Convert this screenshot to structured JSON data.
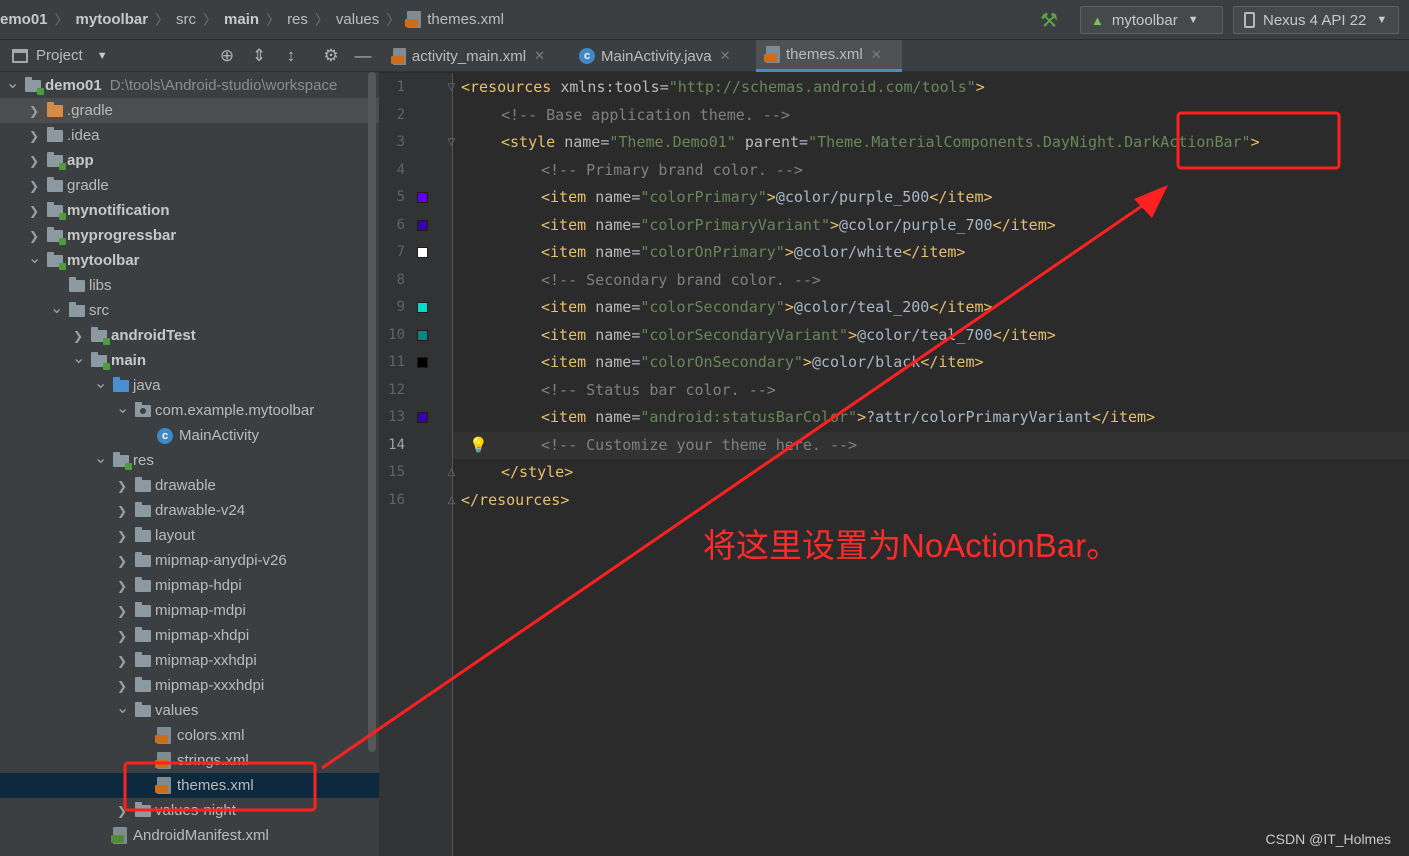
{
  "breadcrumbs": [
    {
      "label": "emo01",
      "bold": true
    },
    {
      "label": "mytoolbar",
      "bold": true
    },
    {
      "label": "src",
      "bold": false
    },
    {
      "label": "main",
      "bold": true
    },
    {
      "label": "res",
      "bold": false
    },
    {
      "label": "values",
      "bold": false
    }
  ],
  "current_file": "themes.xml",
  "toolbar": {
    "run_config": "mytoolbar",
    "device": "Nexus 4 API 22"
  },
  "project_panel": {
    "title": "Project"
  },
  "tree": [
    {
      "label": "demo01",
      "path": "D:\\tools\\Android-studio\\workspace",
      "bold": true,
      "depth": 0,
      "chev": "open",
      "icon": "module"
    },
    {
      "label": ".gradle",
      "bold": false,
      "depth": 1,
      "chev": "closed",
      "icon": "orange",
      "highlight": true
    },
    {
      "label": ".idea",
      "bold": false,
      "depth": 1,
      "chev": "closed",
      "icon": "folder"
    },
    {
      "label": "app",
      "bold": true,
      "depth": 1,
      "chev": "closed",
      "icon": "module"
    },
    {
      "label": "gradle",
      "bold": false,
      "depth": 1,
      "chev": "closed",
      "icon": "folder"
    },
    {
      "label": "mynotification",
      "bold": true,
      "depth": 1,
      "chev": "closed",
      "icon": "module"
    },
    {
      "label": "myprogressbar",
      "bold": true,
      "depth": 1,
      "chev": "closed",
      "icon": "module"
    },
    {
      "label": "mytoolbar",
      "bold": true,
      "depth": 1,
      "chev": "open",
      "icon": "module"
    },
    {
      "label": "libs",
      "bold": false,
      "depth": 2,
      "chev": "none",
      "icon": "folder"
    },
    {
      "label": "src",
      "bold": false,
      "depth": 2,
      "chev": "open",
      "icon": "folder"
    },
    {
      "label": "androidTest",
      "bold": true,
      "depth": 3,
      "chev": "closed",
      "icon": "module"
    },
    {
      "label": "main",
      "bold": true,
      "depth": 3,
      "chev": "open",
      "icon": "module"
    },
    {
      "label": "java",
      "bold": false,
      "depth": 4,
      "chev": "open",
      "icon": "blue"
    },
    {
      "label": "com.example.mytoolbar",
      "bold": false,
      "depth": 5,
      "chev": "open",
      "icon": "package"
    },
    {
      "label": "MainActivity",
      "bold": false,
      "depth": 6,
      "chev": "none",
      "icon": "class"
    },
    {
      "label": "res",
      "bold": false,
      "depth": 4,
      "chev": "open",
      "icon": "res"
    },
    {
      "label": "drawable",
      "bold": false,
      "depth": 5,
      "chev": "closed",
      "icon": "folder"
    },
    {
      "label": "drawable-v24",
      "bold": false,
      "depth": 5,
      "chev": "closed",
      "icon": "folder"
    },
    {
      "label": "layout",
      "bold": false,
      "depth": 5,
      "chev": "closed",
      "icon": "folder"
    },
    {
      "label": "mipmap-anydpi-v26",
      "bold": false,
      "depth": 5,
      "chev": "closed",
      "icon": "folder"
    },
    {
      "label": "mipmap-hdpi",
      "bold": false,
      "depth": 5,
      "chev": "closed",
      "icon": "folder"
    },
    {
      "label": "mipmap-mdpi",
      "bold": false,
      "depth": 5,
      "chev": "closed",
      "icon": "folder"
    },
    {
      "label": "mipmap-xhdpi",
      "bold": false,
      "depth": 5,
      "chev": "closed",
      "icon": "folder"
    },
    {
      "label": "mipmap-xxhdpi",
      "bold": false,
      "depth": 5,
      "chev": "closed",
      "icon": "folder"
    },
    {
      "label": "mipmap-xxxhdpi",
      "bold": false,
      "depth": 5,
      "chev": "closed",
      "icon": "folder"
    },
    {
      "label": "values",
      "bold": false,
      "depth": 5,
      "chev": "open",
      "icon": "folder"
    },
    {
      "label": "colors.xml",
      "bold": false,
      "depth": 6,
      "chev": "none",
      "icon": "xml"
    },
    {
      "label": "strings.xml",
      "bold": false,
      "depth": 6,
      "chev": "none",
      "icon": "xml"
    },
    {
      "label": "themes.xml",
      "bold": false,
      "depth": 6,
      "chev": "none",
      "icon": "xml",
      "selected": true
    },
    {
      "label": "values-night",
      "bold": false,
      "depth": 5,
      "chev": "closed",
      "icon": "folder"
    },
    {
      "label": "AndroidManifest.xml",
      "bold": false,
      "depth": 4,
      "chev": "none",
      "icon": "manifest"
    }
  ],
  "tabs": [
    {
      "label": "activity_main.xml",
      "icon": "xml",
      "active": false
    },
    {
      "label": "MainActivity.java",
      "icon": "class",
      "active": false
    },
    {
      "label": "themes.xml",
      "icon": "xml",
      "active": true
    }
  ],
  "current_line": 14,
  "code_lines": [
    {
      "indent": 0,
      "parts": [
        [
          "tag",
          "<resources "
        ],
        [
          "attr",
          "xmlns:tools"
        ],
        [
          "txt",
          "="
        ],
        [
          "val",
          "\"http://schemas.android.com/tools\""
        ],
        [
          "tag",
          ">"
        ]
      ]
    },
    {
      "indent": 1,
      "parts": [
        [
          "cmt",
          "<!-- Base application theme. -->"
        ]
      ]
    },
    {
      "indent": 1,
      "parts": [
        [
          "tag",
          "<style "
        ],
        [
          "attr",
          "name"
        ],
        [
          "txt",
          "="
        ],
        [
          "val",
          "\"Theme.Demo01\""
        ],
        [
          "txt",
          " "
        ],
        [
          "attr",
          "parent"
        ],
        [
          "txt",
          "="
        ],
        [
          "val",
          "\"Theme.MaterialComponents.DayNight.DarkActionBar\""
        ],
        [
          "tag",
          ">"
        ]
      ]
    },
    {
      "indent": 2,
      "parts": [
        [
          "cmt",
          "<!-- Primary brand color. -->"
        ]
      ]
    },
    {
      "indent": 2,
      "swatch": "#6200ee",
      "parts": [
        [
          "tag",
          "<item "
        ],
        [
          "attr",
          "name"
        ],
        [
          "txt",
          "="
        ],
        [
          "val",
          "\"colorPrimary\""
        ],
        [
          "tag",
          ">"
        ],
        [
          "txt",
          "@color/purple_500"
        ],
        [
          "tag",
          "</item>"
        ]
      ]
    },
    {
      "indent": 2,
      "swatch": "#3700b3",
      "parts": [
        [
          "tag",
          "<item "
        ],
        [
          "attr",
          "name"
        ],
        [
          "txt",
          "="
        ],
        [
          "val",
          "\"colorPrimaryVariant\""
        ],
        [
          "tag",
          ">"
        ],
        [
          "txt",
          "@color/purple_700"
        ],
        [
          "tag",
          "</item>"
        ]
      ]
    },
    {
      "indent": 2,
      "swatch": "#ffffff",
      "parts": [
        [
          "tag",
          "<item "
        ],
        [
          "attr",
          "name"
        ],
        [
          "txt",
          "="
        ],
        [
          "val",
          "\"colorOnPrimary\""
        ],
        [
          "tag",
          ">"
        ],
        [
          "txt",
          "@color/white"
        ],
        [
          "tag",
          "</item>"
        ]
      ]
    },
    {
      "indent": 2,
      "parts": [
        [
          "cmt",
          "<!-- Secondary brand color. -->"
        ]
      ]
    },
    {
      "indent": 2,
      "swatch": "#03dac5",
      "parts": [
        [
          "tag",
          "<item "
        ],
        [
          "attr",
          "name"
        ],
        [
          "txt",
          "="
        ],
        [
          "val",
          "\"colorSecondary\""
        ],
        [
          "tag",
          ">"
        ],
        [
          "txt",
          "@color/teal_200"
        ],
        [
          "tag",
          "</item>"
        ]
      ]
    },
    {
      "indent": 2,
      "swatch": "#018786",
      "parts": [
        [
          "tag",
          "<item "
        ],
        [
          "attr",
          "name"
        ],
        [
          "txt",
          "="
        ],
        [
          "val",
          "\"colorSecondaryVariant\""
        ],
        [
          "tag",
          ">"
        ],
        [
          "txt",
          "@color/teal_700"
        ],
        [
          "tag",
          "</item>"
        ]
      ]
    },
    {
      "indent": 2,
      "swatch": "#000000",
      "parts": [
        [
          "tag",
          "<item "
        ],
        [
          "attr",
          "name"
        ],
        [
          "txt",
          "="
        ],
        [
          "val",
          "\"colorOnSecondary\""
        ],
        [
          "tag",
          ">"
        ],
        [
          "txt",
          "@color/black"
        ],
        [
          "tag",
          "</item>"
        ]
      ]
    },
    {
      "indent": 2,
      "parts": [
        [
          "cmt",
          "<!-- Status bar color. -->"
        ]
      ]
    },
    {
      "indent": 2,
      "swatch": "#3700b3",
      "parts": [
        [
          "tag",
          "<item "
        ],
        [
          "attr",
          "name"
        ],
        [
          "txt",
          "="
        ],
        [
          "val",
          "\"android:statusBarColor\""
        ],
        [
          "tag",
          ">"
        ],
        [
          "txt",
          "?attr/colorPrimaryVariant"
        ],
        [
          "tag",
          "</item>"
        ]
      ]
    },
    {
      "indent": 2,
      "bulb": true,
      "parts": [
        [
          "cmt",
          "<!-- Customize your theme here. -->"
        ]
      ]
    },
    {
      "indent": 1,
      "parts": [
        [
          "tag",
          "</style>"
        ]
      ]
    },
    {
      "indent": 0,
      "parts": [
        [
          "tag",
          "</resources>"
        ]
      ]
    }
  ],
  "annotation": {
    "note": "将这里设置为NoActionBar。",
    "color": "#ff2020"
  },
  "watermark": "CSDN @IT_Holmes",
  "icons": {
    "hammer": "hammer-icon",
    "android": "android-icon",
    "device": "device-icon",
    "project": "project-panel-icon",
    "locate": "crosshair-icon",
    "expand": "expand-all-icon",
    "collapse": "collapse-all-icon",
    "settings": "gear-icon",
    "hide": "minimize-icon"
  }
}
